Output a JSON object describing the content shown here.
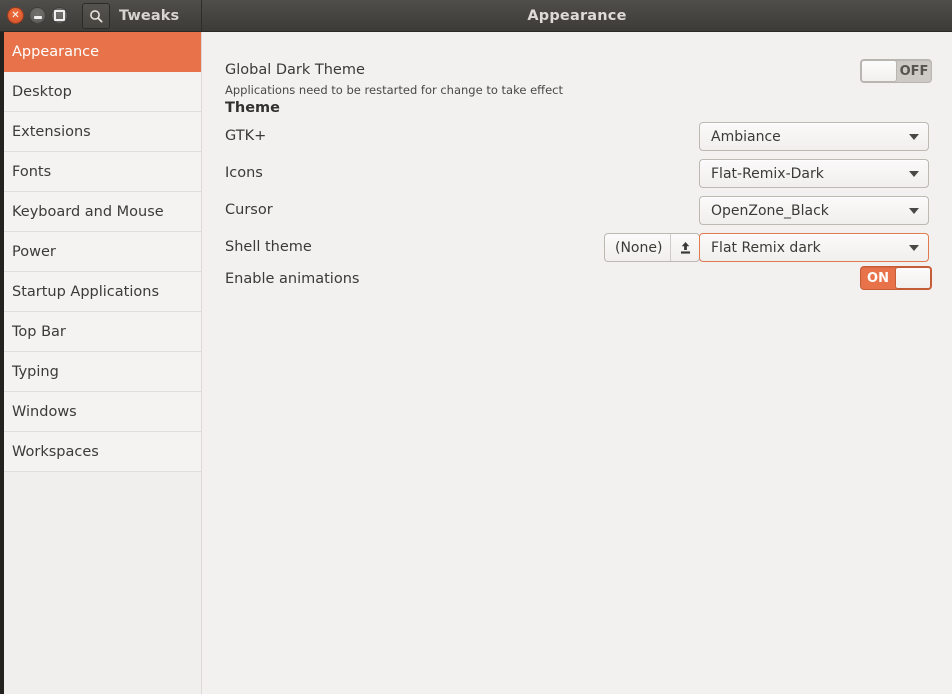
{
  "window": {
    "title": "Appearance",
    "app_name": "Tweaks",
    "controls": {
      "close": "close-button",
      "minimize": "minimize-button",
      "maximize": "maximize-button"
    },
    "search_icon": "search-icon"
  },
  "sidebar": {
    "items": [
      {
        "label": "Appearance",
        "selected": true
      },
      {
        "label": "Desktop",
        "selected": false
      },
      {
        "label": "Extensions",
        "selected": false
      },
      {
        "label": "Fonts",
        "selected": false
      },
      {
        "label": "Keyboard and Mouse",
        "selected": false
      },
      {
        "label": "Power",
        "selected": false
      },
      {
        "label": "Startup Applications",
        "selected": false
      },
      {
        "label": "Top Bar",
        "selected": false
      },
      {
        "label": "Typing",
        "selected": false
      },
      {
        "label": "Windows",
        "selected": false
      },
      {
        "label": "Workspaces",
        "selected": false
      }
    ]
  },
  "main": {
    "global_dark_theme": {
      "label": "Global Dark Theme",
      "description": "Applications need to be restarted for change to take effect",
      "toggle_state": "OFF"
    },
    "theme_section_title": "Theme",
    "gtk": {
      "label": "GTK+",
      "value": "Ambiance"
    },
    "icons": {
      "label": "Icons",
      "value": "Flat-Remix-Dark"
    },
    "cursor": {
      "label": "Cursor",
      "value": "OpenZone_Black"
    },
    "shell_theme": {
      "label": "Shell theme",
      "file_value": "(None)",
      "upload_icon": "upload-icon",
      "value": "Flat Remix dark"
    },
    "enable_animations": {
      "label": "Enable animations",
      "toggle_state": "ON"
    }
  },
  "colors": {
    "accent": "#e8734a",
    "titlebar": "#403e3a",
    "sidebar_bg": "#f4f3f1",
    "content_bg": "#f2f1f0"
  }
}
